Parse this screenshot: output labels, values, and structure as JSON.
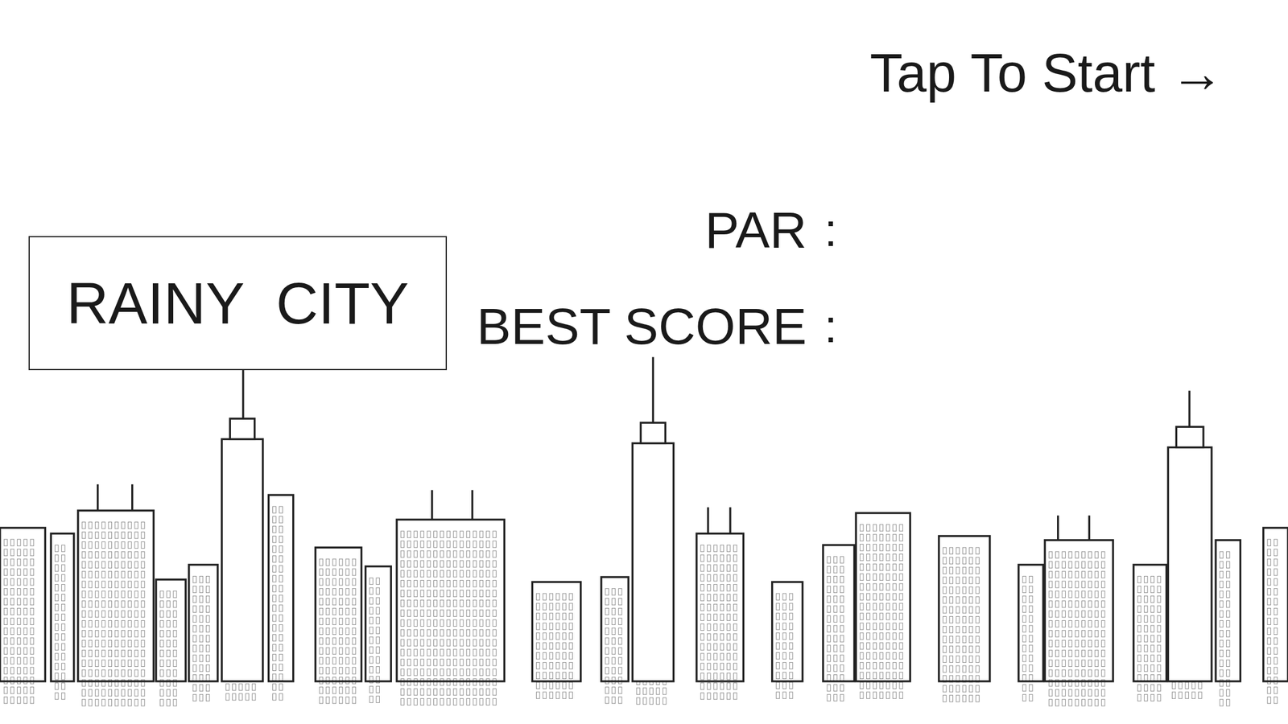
{
  "start_button": {
    "label": "Tap To Start →"
  },
  "title": "RAINY  CITY",
  "stats": [
    {
      "label": "PAR",
      "separator": ":"
    },
    {
      "label": "BEST SCORE",
      "separator": ":"
    }
  ]
}
